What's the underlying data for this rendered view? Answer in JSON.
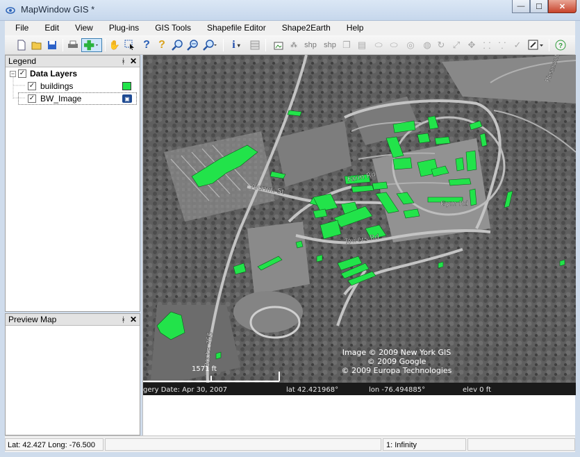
{
  "window": {
    "title": "MapWindow GIS *",
    "buttons": {
      "minimize": "—",
      "maximize": "☐",
      "close": "✕"
    }
  },
  "menu": [
    "File",
    "Edit",
    "View",
    "Plug-ins",
    "GIS Tools",
    "Shapefile Editor",
    "Shape2Earth",
    "Help"
  ],
  "toolbar": {
    "icons": [
      "new-project-icon",
      "open-icon",
      "save-icon",
      "print-icon",
      "add-layer-icon",
      "pan-icon",
      "select-icon",
      "identify-icon",
      "query-icon",
      "zoom-in-icon",
      "zoom-out-icon",
      "zoom-extent-icon",
      "info-icon",
      "attribute-table-icon"
    ],
    "shp_label_1": "shp",
    "shp_label_2": "shp"
  },
  "legend": {
    "title": "Legend",
    "pin": "ᚼ",
    "close": "✕",
    "group_label": "Data Layers",
    "layers": [
      {
        "name": "buildings",
        "checked": true,
        "color": "#22e34a"
      },
      {
        "name": "BW_Image",
        "checked": true,
        "selected": true
      }
    ]
  },
  "preview": {
    "title": "Preview Map",
    "pin": "ᚼ",
    "close": "✕"
  },
  "map": {
    "road_labels": [
      "Farm Rd",
      "Gym Rd",
      "Alumni St",
      "Towers Rd",
      "Pleasant Gr",
      "Route 366"
    ],
    "copyright": [
      "Image © 2009 New York GIS",
      "© 2009 Google",
      "© 2009 Europa Technologies"
    ],
    "scale_label": "1571 ft",
    "info_bar": {
      "imagery_date": "gery Date: Apr 30, 2007",
      "lat": "lat   42.421968°",
      "lon": "lon  -76.494885°",
      "elev": "elev      0 ft"
    }
  },
  "status": {
    "coords": "Lat: 42.427 Long: -76.500",
    "scale": "1: Infinity"
  }
}
